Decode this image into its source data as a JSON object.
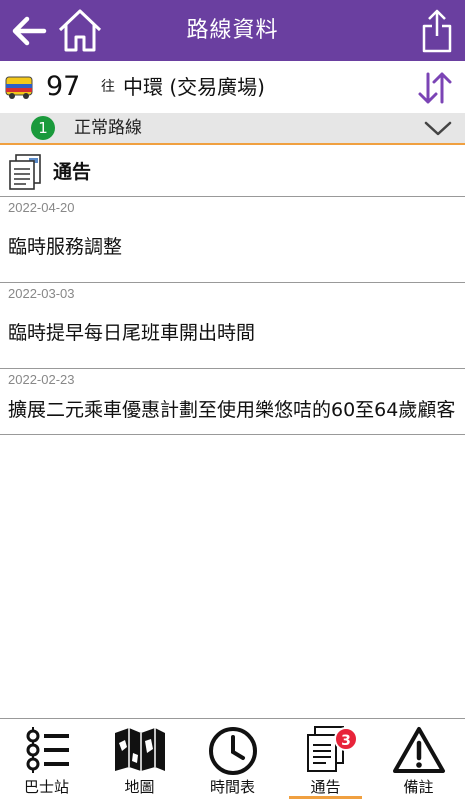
{
  "header": {
    "title": "路線資料",
    "back_icon": "arrow-left-icon",
    "home_icon": "home-icon",
    "share_icon": "share-icon",
    "color": "#6a3fa0"
  },
  "route": {
    "number": "97",
    "direction_prefix": "往",
    "destination": "中環 (交易廣場)",
    "bus_icon": "bus-icon",
    "swap_icon": "swap-direction-icon"
  },
  "variant": {
    "badge": "1",
    "label": "正常路線",
    "expand_icon": "chevron-down-icon",
    "badge_color": "#1a9a3c"
  },
  "section": {
    "title": "通告",
    "icon": "notice-icon"
  },
  "notices": [
    {
      "date": "2022-04-20",
      "text": "臨時服務調整"
    },
    {
      "date": "2022-03-03",
      "text": "臨時提早每日尾班車開出時間"
    },
    {
      "date": "2022-02-23",
      "text": "擴展二元乘車優惠計劃至使用樂悠咭的60至64歲顧客"
    }
  ],
  "tabs": [
    {
      "label": "巴士站",
      "icon": "bus-stop-list-icon"
    },
    {
      "label": "地圖",
      "icon": "map-icon"
    },
    {
      "label": "時間表",
      "icon": "clock-icon"
    },
    {
      "label": "通告",
      "icon": "notice-icon",
      "count": "3",
      "active": true
    },
    {
      "label": "備註",
      "icon": "warning-icon"
    }
  ],
  "colors": {
    "accent": "#f0a040",
    "badge_red": "#e8243a"
  }
}
